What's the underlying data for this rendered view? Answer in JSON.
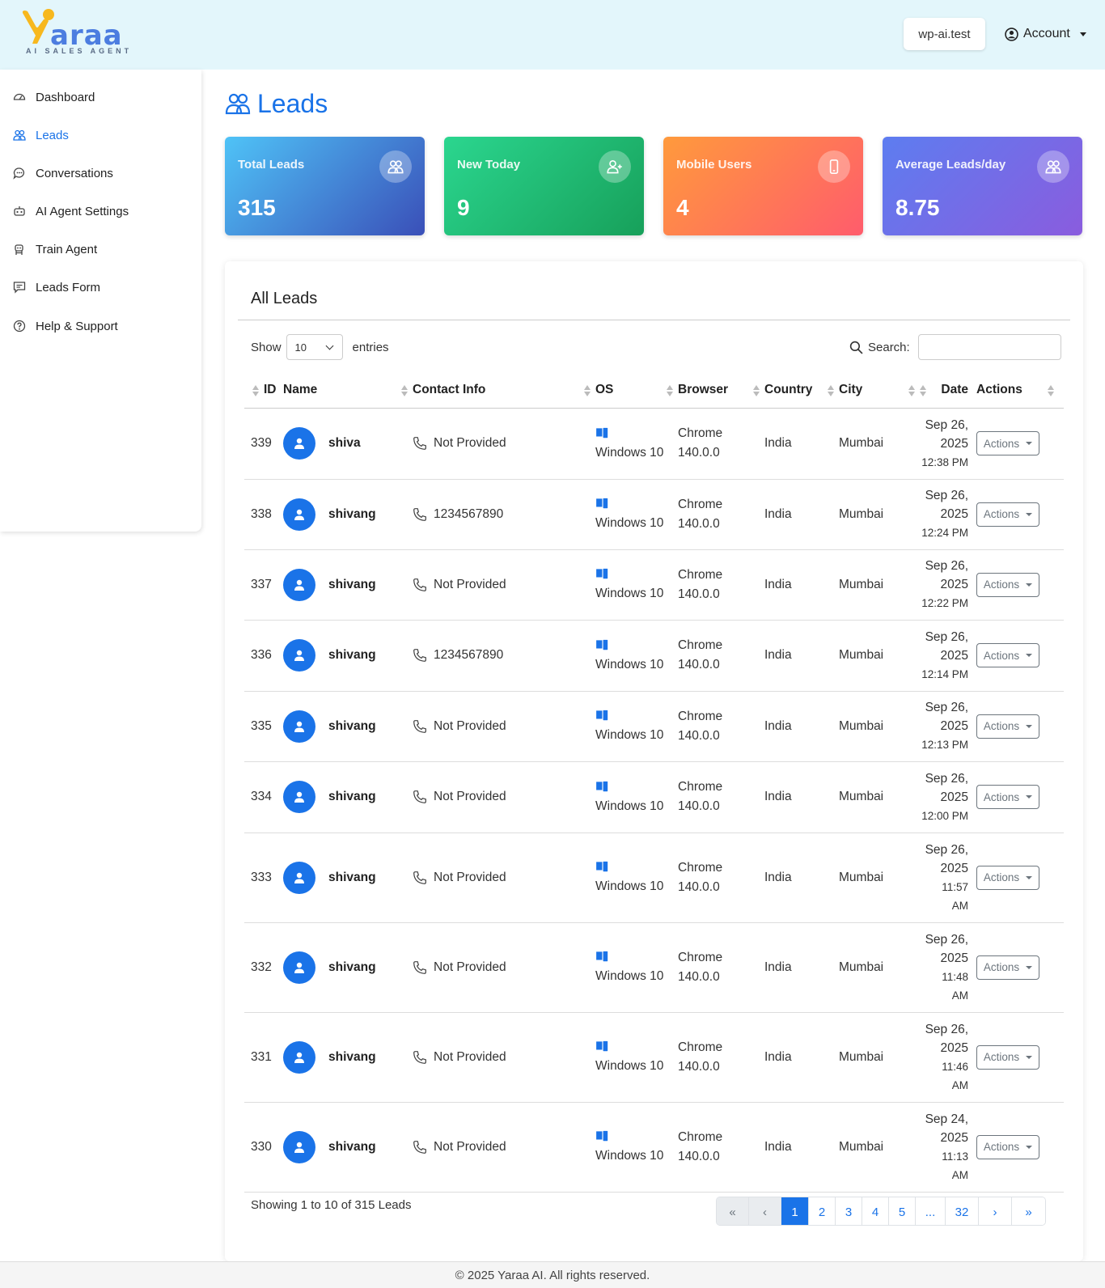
{
  "brand": {
    "name": "araa",
    "tagline": "AI SALES AGENT",
    "accent": "#1a73e8",
    "logo_yellow": "#f7b81e"
  },
  "header": {
    "site": "wp-ai.test",
    "account": "Account"
  },
  "sidebar": {
    "items": [
      {
        "label": "Dashboard",
        "icon": "dashboard-icon"
      },
      {
        "label": "Leads",
        "icon": "people-icon",
        "active": true
      },
      {
        "label": "Conversations",
        "icon": "chat-icon"
      },
      {
        "label": "AI Agent Settings",
        "icon": "robot-icon"
      },
      {
        "label": "Train Agent",
        "icon": "robot-train-icon"
      },
      {
        "label": "Leads Form",
        "icon": "form-icon"
      },
      {
        "label": "Help & Support",
        "icon": "help-icon"
      }
    ]
  },
  "page": {
    "title": "Leads"
  },
  "stats": [
    {
      "label": "Total Leads",
      "value": "315",
      "icon": "people-icon"
    },
    {
      "label": "New Today",
      "value": "9",
      "icon": "person-add-icon"
    },
    {
      "label": "Mobile Users",
      "value": "4",
      "icon": "phone-icon"
    },
    {
      "label": "Average Leads/day",
      "value": "8.75",
      "icon": "people-icon"
    }
  ],
  "table": {
    "title": "All Leads",
    "show_label": "Show",
    "entries_label": "entries",
    "page_length": "10",
    "search_label": "Search:",
    "search_value": "",
    "columns": [
      "ID",
      "Name",
      "Contact Info",
      "OS",
      "Browser",
      "Country",
      "City",
      "Date",
      "Actions"
    ],
    "rows": [
      {
        "id": "339",
        "name": "shiva",
        "contact": "Not Provided",
        "os": "Windows 10",
        "browser": "Chrome",
        "browser_version": "140.0.0",
        "country": "India",
        "city": "Mumbai",
        "date": "Sep 26,",
        "year": "2025",
        "time": "12:38 PM",
        "action": "Actions"
      },
      {
        "id": "338",
        "name": "shivang",
        "contact": "1234567890",
        "os": "Windows 10",
        "browser": "Chrome",
        "browser_version": "140.0.0",
        "country": "India",
        "city": "Mumbai",
        "date": "Sep 26,",
        "year": "2025",
        "time": "12:24 PM",
        "action": "Actions"
      },
      {
        "id": "337",
        "name": "shivang",
        "contact": "Not Provided",
        "os": "Windows 10",
        "browser": "Chrome",
        "browser_version": "140.0.0",
        "country": "India",
        "city": "Mumbai",
        "date": "Sep 26,",
        "year": "2025",
        "time": "12:22 PM",
        "action": "Actions"
      },
      {
        "id": "336",
        "name": "shivang",
        "contact": "1234567890",
        "os": "Windows 10",
        "browser": "Chrome",
        "browser_version": "140.0.0",
        "country": "India",
        "city": "Mumbai",
        "date": "Sep 26,",
        "year": "2025",
        "time": "12:14 PM",
        "action": "Actions"
      },
      {
        "id": "335",
        "name": "shivang",
        "contact": "Not Provided",
        "os": "Windows 10",
        "browser": "Chrome",
        "browser_version": "140.0.0",
        "country": "India",
        "city": "Mumbai",
        "date": "Sep 26,",
        "year": "2025",
        "time": "12:13 PM",
        "action": "Actions"
      },
      {
        "id": "334",
        "name": "shivang",
        "contact": "Not Provided",
        "os": "Windows 10",
        "browser": "Chrome",
        "browser_version": "140.0.0",
        "country": "India",
        "city": "Mumbai",
        "date": "Sep 26,",
        "year": "2025",
        "time": "12:00 PM",
        "action": "Actions"
      },
      {
        "id": "333",
        "name": "shivang",
        "contact": "Not Provided",
        "os": "Windows 10",
        "browser": "Chrome",
        "browser_version": "140.0.0",
        "country": "India",
        "city": "Mumbai",
        "date": "Sep 26,",
        "year": "2025",
        "time": "11:57",
        "ampm": "AM",
        "action": "Actions"
      },
      {
        "id": "332",
        "name": "shivang",
        "contact": "Not Provided",
        "os": "Windows 10",
        "browser": "Chrome",
        "browser_version": "140.0.0",
        "country": "India",
        "city": "Mumbai",
        "date": "Sep 26,",
        "year": "2025",
        "time": "11:48",
        "ampm": "AM",
        "action": "Actions"
      },
      {
        "id": "331",
        "name": "shivang",
        "contact": "Not Provided",
        "os": "Windows 10",
        "browser": "Chrome",
        "browser_version": "140.0.0",
        "country": "India",
        "city": "Mumbai",
        "date": "Sep 26,",
        "year": "2025",
        "time": "11:46",
        "ampm": "AM",
        "action": "Actions"
      },
      {
        "id": "330",
        "name": "shivang",
        "contact": "Not Provided",
        "os": "Windows 10",
        "browser": "Chrome",
        "browser_version": "140.0.0",
        "country": "India",
        "city": "Mumbai",
        "date": "Sep 24,",
        "year": "2025",
        "time": "11:13",
        "ampm": "AM",
        "action": "Actions"
      }
    ],
    "info": "Showing 1 to 10 of 315 Leads",
    "pagination": [
      {
        "label": "«",
        "state": "disabled"
      },
      {
        "label": "‹",
        "state": "disabled"
      },
      {
        "label": "1",
        "state": "active"
      },
      {
        "label": "2",
        "state": ""
      },
      {
        "label": "3",
        "state": ""
      },
      {
        "label": "4",
        "state": ""
      },
      {
        "label": "5",
        "state": ""
      },
      {
        "label": "...",
        "state": ""
      },
      {
        "label": "32",
        "state": ""
      },
      {
        "label": "›",
        "state": ""
      },
      {
        "label": "»",
        "state": ""
      }
    ]
  },
  "footer": {
    "text": "© 2025 Yaraa AI. All rights reserved."
  }
}
